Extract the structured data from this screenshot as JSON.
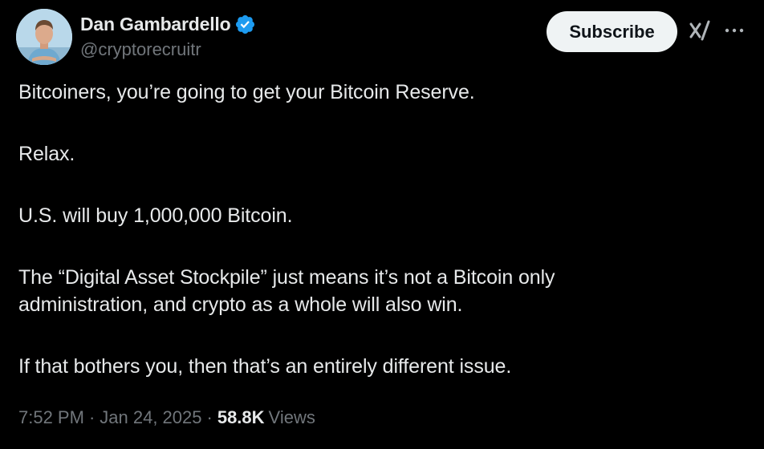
{
  "author": {
    "display_name": "Dan Gambardello",
    "handle": "@cryptorecruitr",
    "verified": true,
    "avatar_icon": "profile-photo"
  },
  "header": {
    "subscribe_label": "Subscribe",
    "grok_icon": "grok-icon",
    "more_icon": "ellipsis-icon"
  },
  "tweet": {
    "lines": [
      "Bitcoiners, you’re going to get your Bitcoin Reserve.",
      "Relax.",
      "U.S. will buy 1,000,000 Bitcoin.",
      "The “Digital Asset Stockpile” just means it’s not a Bitcoin only",
      "administration, and crypto as a whole will also win.",
      "If that bothers you, then that’s an entirely different issue."
    ]
  },
  "meta": {
    "time": "7:52 PM",
    "date": "Jan 24, 2025",
    "views_count": "58.8K",
    "views_label": "Views"
  },
  "colors": {
    "background": "#000000",
    "text_primary": "#e7e9ea",
    "text_secondary": "#71767b",
    "verified_badge": "#1d9bf0",
    "subscribe_bg": "#eff3f4"
  }
}
